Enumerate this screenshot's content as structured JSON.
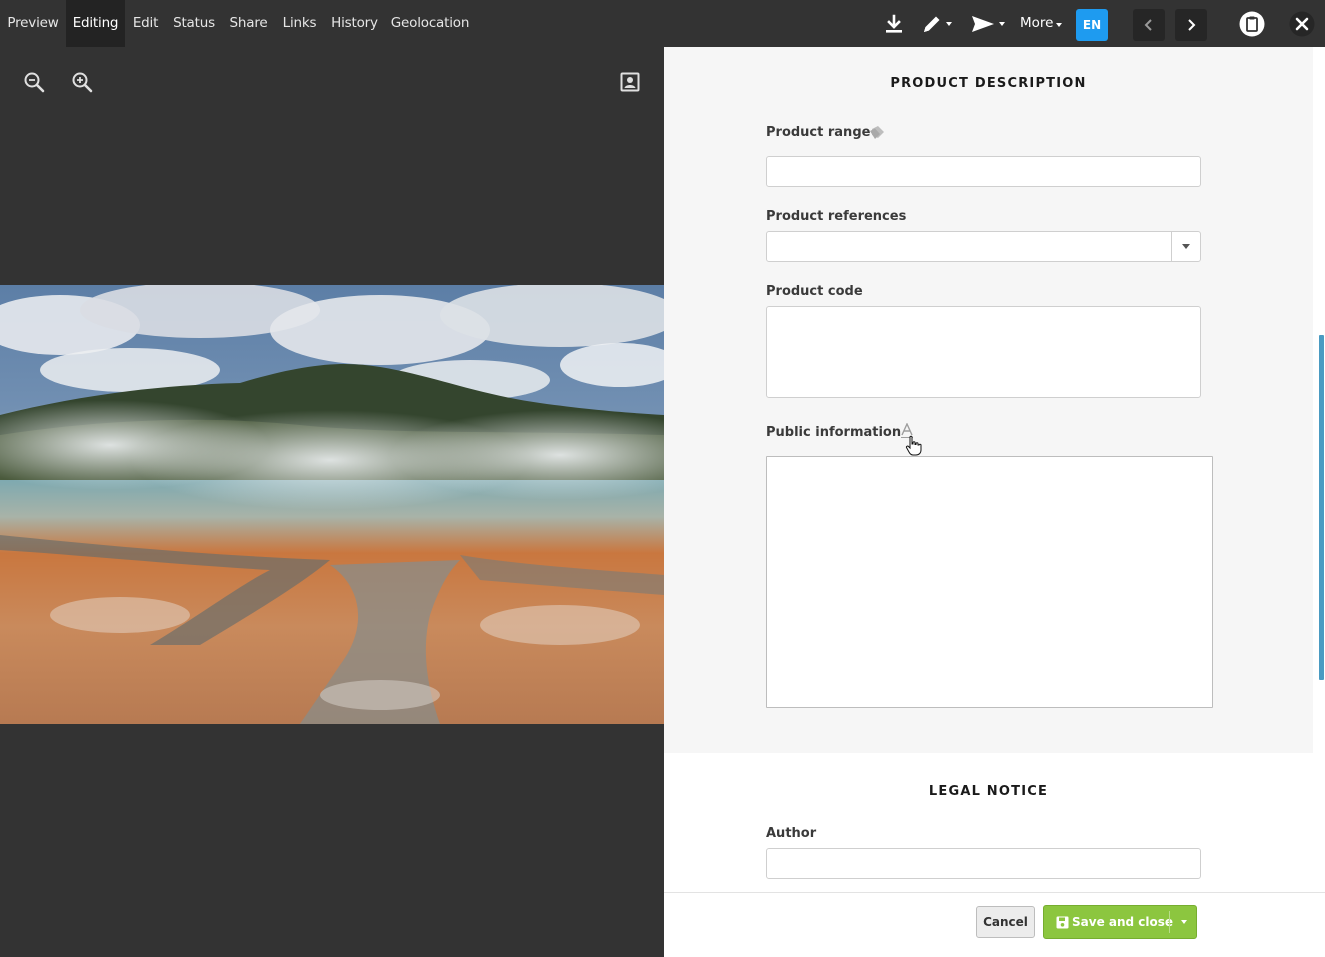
{
  "topbar": {
    "tabs": [
      {
        "label": "Preview"
      },
      {
        "label": "Editing"
      },
      {
        "label": "Edit"
      },
      {
        "label": "Status"
      },
      {
        "label": "Share"
      },
      {
        "label": "Links"
      },
      {
        "label": "History"
      },
      {
        "label": "Geolocation"
      }
    ],
    "active_tab": "Editing",
    "more_label": "More",
    "language": "EN",
    "icons": [
      "download-icon",
      "pencil-icon",
      "send-icon",
      "chevron-left-icon",
      "chevron-right-icon",
      "clipboard-icon",
      "close-icon"
    ]
  },
  "viewer": {
    "icons": [
      "zoom-out-icon",
      "zoom-in-icon",
      "portrait-icon"
    ]
  },
  "form": {
    "product_section": {
      "title": "PRODUCT DESCRIPTION",
      "product_range_label": "Product range",
      "product_range_value": "",
      "product_references_label": "Product references",
      "product_references_value": "",
      "product_code_label": "Product code",
      "product_code_value": "",
      "public_information_label": "Public information",
      "public_information_value": ""
    },
    "legal_section": {
      "title": "LEGAL NOTICE",
      "author_label": "Author",
      "author_value": ""
    }
  },
  "footer": {
    "cancel_label": "Cancel",
    "save_label": "Save and close"
  },
  "colors": {
    "accent_blue": "#1e9bf0",
    "save_green": "#8cc63f",
    "topbar": "#333333"
  }
}
